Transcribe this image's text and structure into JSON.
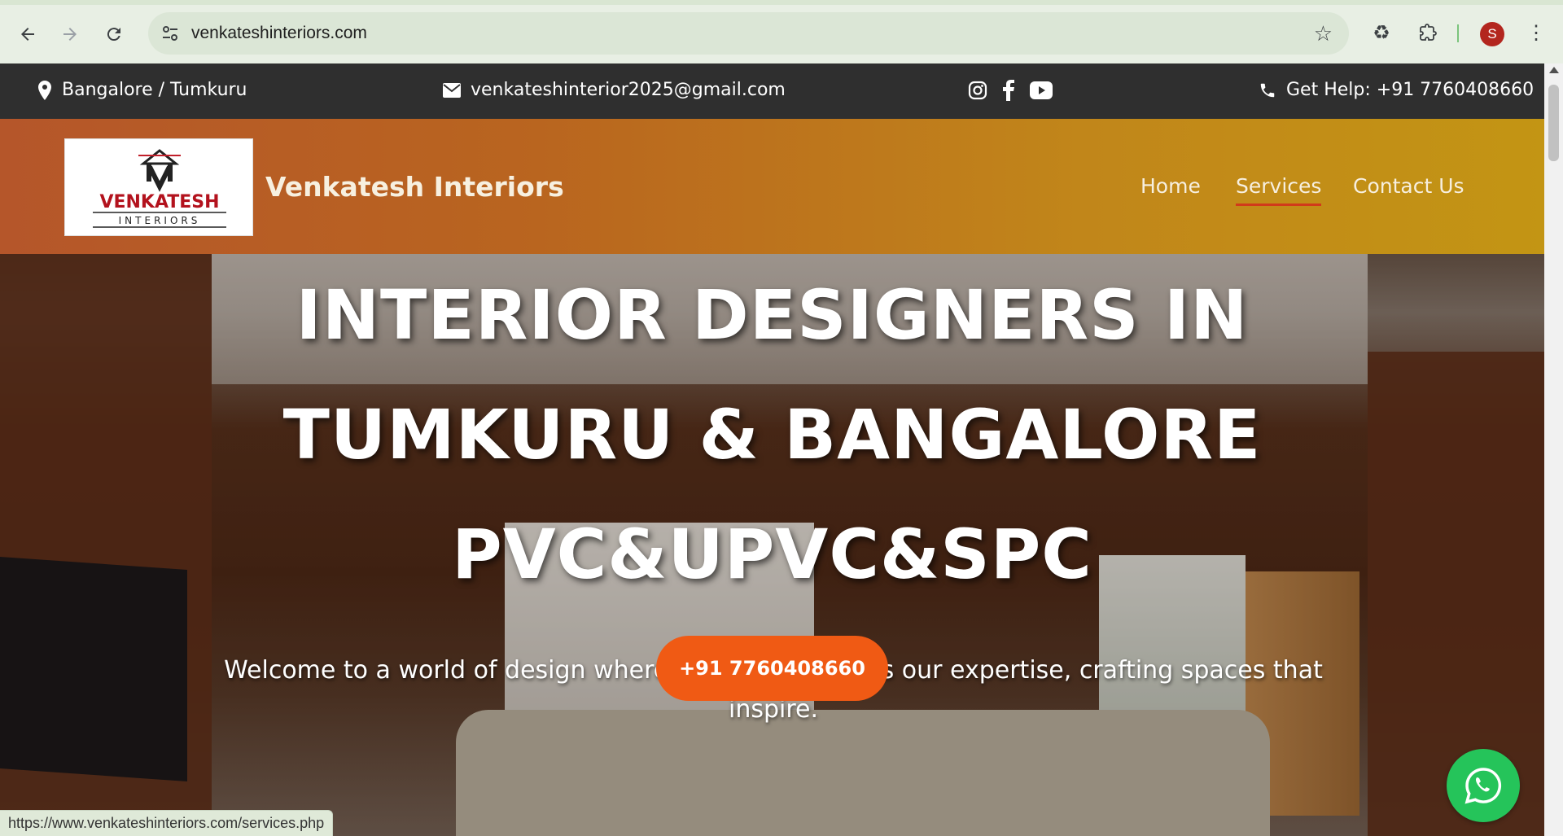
{
  "browser": {
    "url": "venkateshinteriors.com",
    "avatar_letter": "S",
    "status_url": "https://www.venkateshinteriors.com/services.php",
    "icons": [
      "back-icon",
      "forward-icon",
      "reload-icon",
      "site-info-icon",
      "bookmark-star-icon",
      "recycle-icon",
      "extensions-icon",
      "kebab-menu-icon"
    ]
  },
  "topbar": {
    "location": "Bangalore / Tumkuru",
    "email": "venkateshinterior2025@gmail.com",
    "help": "Get Help: +91 7760408660",
    "social": [
      "instagram-icon",
      "facebook-icon",
      "youtube-icon"
    ]
  },
  "header": {
    "brand": "Venkatesh Interiors",
    "logo_text": "VENKATESH",
    "logo_sub": "INTERIORS",
    "menu": [
      {
        "label": "Home"
      },
      {
        "label": "Services",
        "active": true
      },
      {
        "label": "Contact Us"
      }
    ]
  },
  "hero": {
    "line1": "INTERIOR DESIGNERS IN",
    "line2": "TUMKURU & BANGALORE",
    "line3": "PVC&UPVC&SPC",
    "lead": "Welcome to a world of design where your vision meets our expertise, crafting spaces that inspire.",
    "cta": "+91 7760408660"
  },
  "colors": {
    "topbar_bg": "#2f2f2f",
    "cta": "#f05a14",
    "whatsapp": "#25c45a",
    "active_underline": "#d13a1a"
  }
}
